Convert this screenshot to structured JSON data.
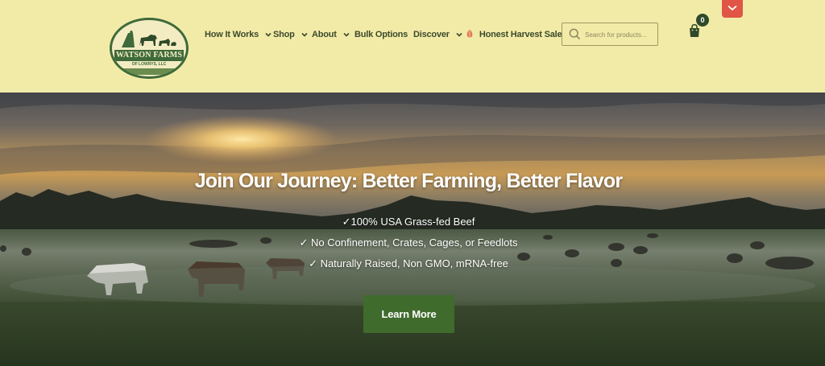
{
  "brand": {
    "logo_name": "WATSON FARMS",
    "logo_subtitle": "OF LOWRYS, LLC"
  },
  "nav": {
    "items": [
      {
        "label": "How It Works",
        "has_dropdown": true
      },
      {
        "label": "Shop",
        "has_dropdown": true
      },
      {
        "label": "About",
        "has_dropdown": true
      },
      {
        "label": "Bulk Options",
        "has_dropdown": false
      },
      {
        "label": "Discover",
        "has_dropdown": true
      },
      {
        "label": "Honest Harvest Sale",
        "has_dropdown": false,
        "icon": "gift-icon"
      }
    ]
  },
  "search": {
    "placeholder": "Search for products..."
  },
  "cart": {
    "count": "0"
  },
  "hero": {
    "title": "Join Our Journey: Better Farming, Better Flavor",
    "features": [
      "✓100% USA Grass-fed Beef",
      "✓ No Confinement, Crates, Cages, or Feedlots",
      "✓ Naturally Raised, Non GMO, mRNA-free"
    ],
    "cta_label": "Learn More"
  },
  "colors": {
    "header_bg": "#f2eba8",
    "brand_green": "#3f6b2c",
    "nav_text": "#3c4a2c",
    "accent_red": "#e05545"
  }
}
